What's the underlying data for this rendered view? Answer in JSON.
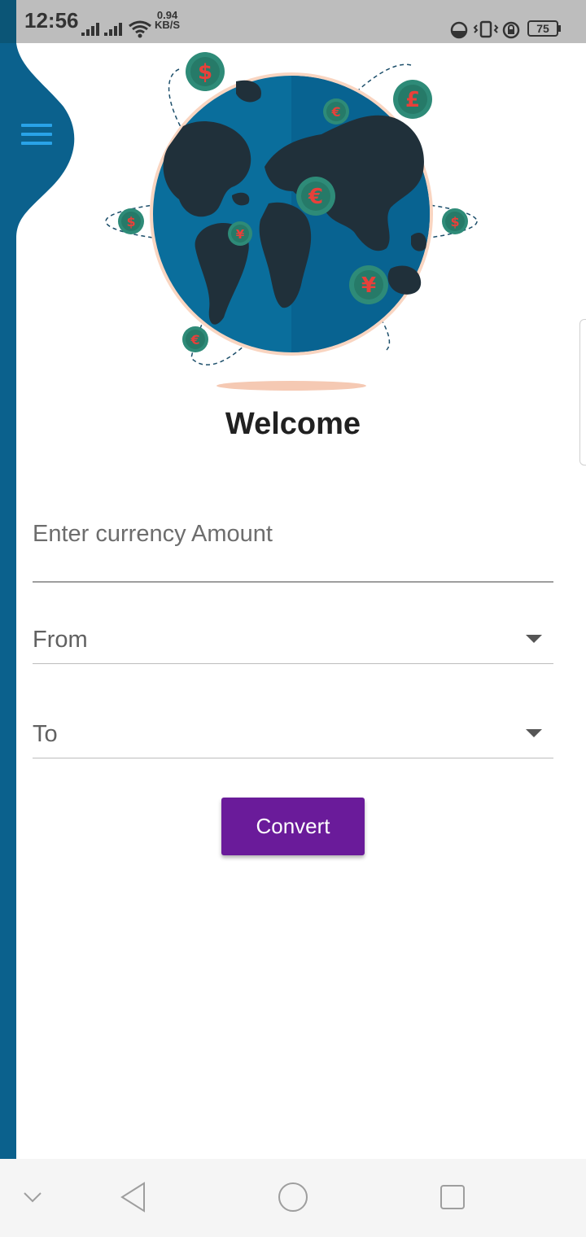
{
  "status_bar": {
    "time": "12:56",
    "speed_value": "0.94",
    "speed_unit": "KB/S",
    "battery": "75"
  },
  "header": {
    "menu_icon": "hamburger-menu-icon"
  },
  "illustration": {
    "icon": "globe-currency-illustration",
    "coin_symbols": [
      "$",
      "£",
      "€",
      "€",
      "$",
      "$",
      "¥",
      "¥",
      "€"
    ]
  },
  "main": {
    "welcome": "Welcome",
    "amount_placeholder": "Enter currency Amount",
    "from_label": "From",
    "to_label": "To",
    "convert_label": "Convert"
  },
  "colors": {
    "accent": "#6a1b9a",
    "drawer": "#0b618d",
    "menu_icon": "#29a3e8",
    "globe_ocean": "#0a6e9c",
    "globe_land": "#20303a",
    "coin": "#2e8b78",
    "coin_symbol": "#e8403a"
  },
  "nav_bar": {
    "icons": [
      "chevron-down-icon",
      "back-icon",
      "home-icon",
      "recents-icon"
    ]
  }
}
